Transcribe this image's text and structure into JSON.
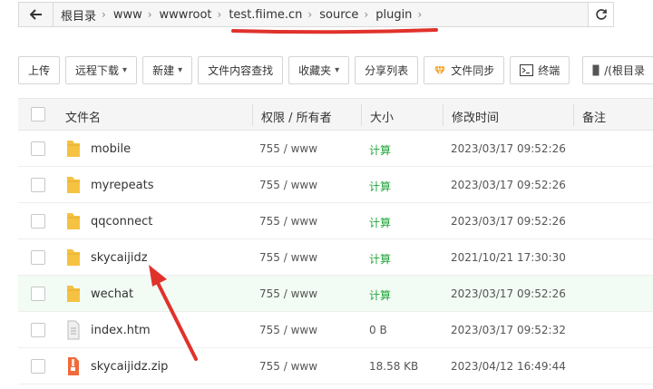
{
  "breadcrumb": {
    "items": [
      "根目录",
      "www",
      "wwwroot",
      "test.fiime.cn",
      "source",
      "plugin"
    ]
  },
  "toolbar": {
    "upload": "上传",
    "remote_download": "远程下载",
    "new": "新建",
    "content_search": "文件内容查找",
    "favorites": "收藏夹",
    "share_list": "分享列表",
    "file_sync": "文件同步",
    "terminal": "终端",
    "root_disk": "/(根目录"
  },
  "table": {
    "headers": {
      "name": "文件名",
      "perm": "权限 / 所有者",
      "size": "大小",
      "mtime": "修改时间",
      "remark": "备注"
    },
    "rows": [
      {
        "name": "mobile",
        "perm": "755 / www",
        "size": "计算",
        "mtime": "2023/03/17 09:52:26",
        "type": "folder"
      },
      {
        "name": "myrepeats",
        "perm": "755 / www",
        "size": "计算",
        "mtime": "2023/03/17 09:52:26",
        "type": "folder"
      },
      {
        "name": "qqconnect",
        "perm": "755 / www",
        "size": "计算",
        "mtime": "2023/03/17 09:52:26",
        "type": "folder"
      },
      {
        "name": "skycaijidz",
        "perm": "755 / www",
        "size": "计算",
        "mtime": "2021/10/21 17:30:30",
        "type": "folder"
      },
      {
        "name": "wechat",
        "perm": "755 / www",
        "size": "计算",
        "mtime": "2023/03/17 09:52:26",
        "type": "folder"
      },
      {
        "name": "index.htm",
        "perm": "755 / www",
        "size": "0 B",
        "mtime": "2023/03/17 09:52:32",
        "type": "file"
      },
      {
        "name": "skycaijidz.zip",
        "perm": "755 / www",
        "size": "18.58 KB",
        "mtime": "2023/04/12 16:49:44",
        "type": "zip"
      }
    ]
  },
  "colors": {
    "accent_green": "#20a53a",
    "annotation_red": "#e0322b",
    "folder_yellow": "#f5c242"
  }
}
